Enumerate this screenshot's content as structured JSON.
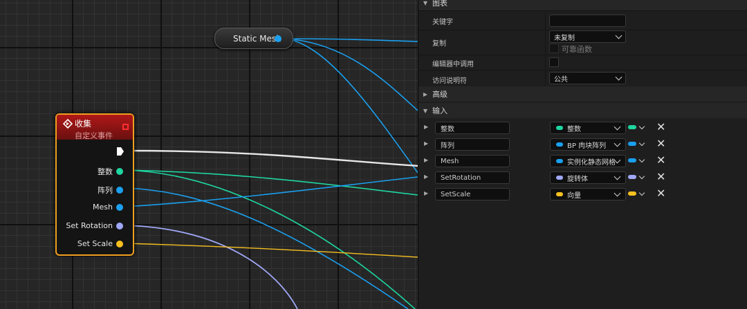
{
  "graph": {
    "static_mesh_node": {
      "label": "Static Mesh",
      "pin_color": "#1aa0f0"
    },
    "event_node": {
      "title": "收集",
      "subtitle": "自定义事件",
      "pins": [
        {
          "label": "整数",
          "color": "#1ed6a0"
        },
        {
          "label": "阵列",
          "color": "#1aa0f0"
        },
        {
          "label": "Mesh",
          "color": "#1aa0f0"
        },
        {
          "label": "Set Rotation",
          "color": "#a0a8f8"
        },
        {
          "label": "Set Scale",
          "color": "#f8c020"
        }
      ]
    }
  },
  "panel": {
    "graph_section": "图表",
    "keyword_label": "关键字",
    "keyword_value": "",
    "replicate_label": "复制",
    "replicate_value": "未复制",
    "reliable_label": "可靠函数",
    "call_in_editor_label": "编辑器中调用",
    "access_label": "访问说明符",
    "access_value": "公共",
    "advanced_section": "高级",
    "inputs_section": "输入",
    "inputs": [
      {
        "name": "整数",
        "type": "整数",
        "color": "#1ed6a0"
      },
      {
        "name": "阵列",
        "type": "BP 肉块阵列",
        "color": "#1aa0f0"
      },
      {
        "name": "Mesh",
        "type": "实例化静态网格",
        "color": "#1aa0f0"
      },
      {
        "name": "SetRotation",
        "type": "旋转体",
        "color": "#a0a8f8"
      },
      {
        "name": "SetScale",
        "type": "向量",
        "color": "#f8c020"
      }
    ]
  }
}
